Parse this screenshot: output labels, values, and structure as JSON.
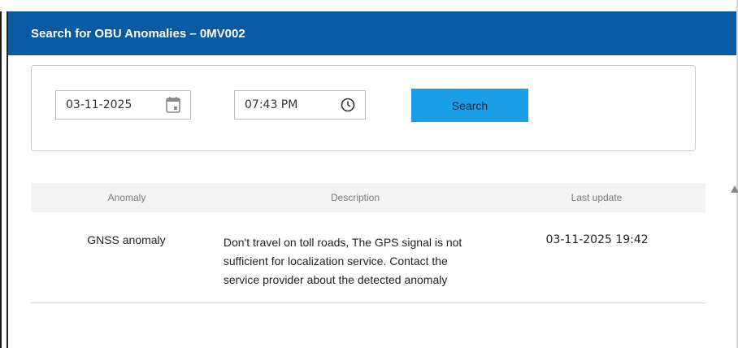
{
  "header": {
    "title": "Search for OBU Anomalies – 0MV002",
    "background": "#0a5aa3"
  },
  "search": {
    "date_value": "03-11-2025",
    "date_icon": "calendar-icon",
    "time_value": "07:43 PM",
    "time_icon": "clock-icon",
    "button_label": "Search",
    "button_color": "#1a9ee8"
  },
  "table": {
    "columns": [
      "Anomaly",
      "Description",
      "Last update"
    ],
    "rows": [
      {
        "anomaly": "GNSS anomaly",
        "description": "Don't travel on toll roads, The GPS signal is not sufficient for localization service. Contact the service provider about the detected anomaly",
        "last_update": "03-11-2025 19:42"
      }
    ]
  }
}
